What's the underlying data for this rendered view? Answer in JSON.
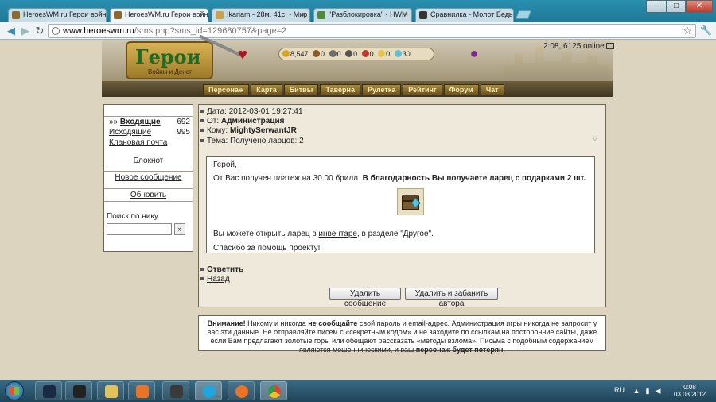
{
  "browser": {
    "tabs": [
      {
        "title": "HeroesWM.ru Герои войны"
      },
      {
        "title": "HeroesWM.ru Герои войны"
      },
      {
        "title": "Ikariam - 28м. 41с. - Мир"
      },
      {
        "title": "\"Разблокировка\" - HWM"
      },
      {
        "title": "Сравнилка - Молот Ведьм"
      }
    ],
    "window_controls": {
      "minimize": "–",
      "maximize": "□",
      "close": "✕"
    },
    "url_host": "www.heroeswm.ru",
    "url_path": "/sms.php?sms_id=129680757&page=2",
    "icons": [
      "back-icon",
      "forward-icon",
      "reload-icon",
      "globe-icon",
      "star-icon",
      "wrench-icon"
    ]
  },
  "game": {
    "logo_title": "Герои",
    "logo_subtitle": "Войны и Денег",
    "resources": [
      {
        "value": "8,547",
        "color": "#d9a520"
      },
      {
        "value": "0",
        "color": "#8b5a2b"
      },
      {
        "value": "0",
        "color": "#6d6d6d"
      },
      {
        "value": "0",
        "color": "#555555"
      },
      {
        "value": "0",
        "color": "#c0392b"
      },
      {
        "value": "0",
        "color": "#e8c547"
      },
      {
        "value": "30",
        "color": "#5cc0d8"
      }
    ],
    "online_status": "2:08, 6125 online",
    "menu": [
      "Персонаж",
      "Карта",
      "Битвы",
      "Таверна",
      "Рулетка",
      "Рейтинг",
      "Форум",
      "Чат"
    ]
  },
  "mailbox": {
    "inbox_prefix": "»»",
    "inbox_label": "Входящие",
    "inbox_count": "692",
    "outbox_label": "Исходящие",
    "outbox_count": "995",
    "clan_mail": "Клановая почта",
    "notepad": "Блокнот",
    "new_message": "Новое сообщение",
    "refresh": "Обновить",
    "search_label": "Поиск по нику",
    "search_value": "",
    "search_go": "»"
  },
  "message": {
    "date_label": "Дата:",
    "date_value": "2012-03-01 19:27:41",
    "from_label": "От:",
    "from_value": "Администрация",
    "to_label": "Кому:",
    "to_value": "MightySerwantJR",
    "subject_label": "Тема:",
    "subject_value": "Получено ларцов: 2",
    "greeting": "Герой,",
    "body_plain": "От Вас получен платеж на 30.00 брилл.",
    "body_bold": "В благодарность Вы получаете ларец с подарками 2 шт.",
    "open_prefix": "Вы можете открыть ларец в",
    "open_link": "инвентаре",
    "open_suffix": ", в разделе \"Другое\".",
    "thanks": "Спасибо за помощь проекту!",
    "reply": "Ответить",
    "back": "Назад",
    "delete_button": "Удалить сообщение",
    "delete_ban_button": "Удалить и забанить автора"
  },
  "warning": {
    "lead": "Внимание!",
    "part1": "Никому и никогда",
    "part2": "не сообщайте",
    "part3": "свой пароль и email-адрес. Администрация игры никогда не запросит у вас эти данные. Не отправляйте писем с «секретным кодом» и не заходите по ссылкам на посторонние сайты, даже если Вам предлагают золотые горы или обещают рассказать «методы взлома». Письма с подобным содержанием являются мошенническими, и ваш",
    "part4": "персонаж будет потерян",
    "part5": "."
  },
  "taskbar": {
    "apps": [
      {
        "name": "league-app",
        "color": "#1a2a44",
        "active": false
      },
      {
        "name": "screenshot-app",
        "color": "#222222",
        "active": false
      },
      {
        "name": "explorer-app",
        "color": "#e2c35a",
        "active": false
      },
      {
        "name": "media-player-app",
        "color": "#e8742a",
        "active": false
      },
      {
        "name": "world-of-tanks-app",
        "color": "#3a3a3a",
        "active": false
      },
      {
        "name": "skype-app",
        "color": "#1fa5e0",
        "active": true
      },
      {
        "name": "firefox-app",
        "color": "#e8742a",
        "active": false
      },
      {
        "name": "chrome-app",
        "color": "#d9432f",
        "active": true
      }
    ],
    "language": "RU",
    "time": "0:08",
    "date": "03.03.2012"
  }
}
